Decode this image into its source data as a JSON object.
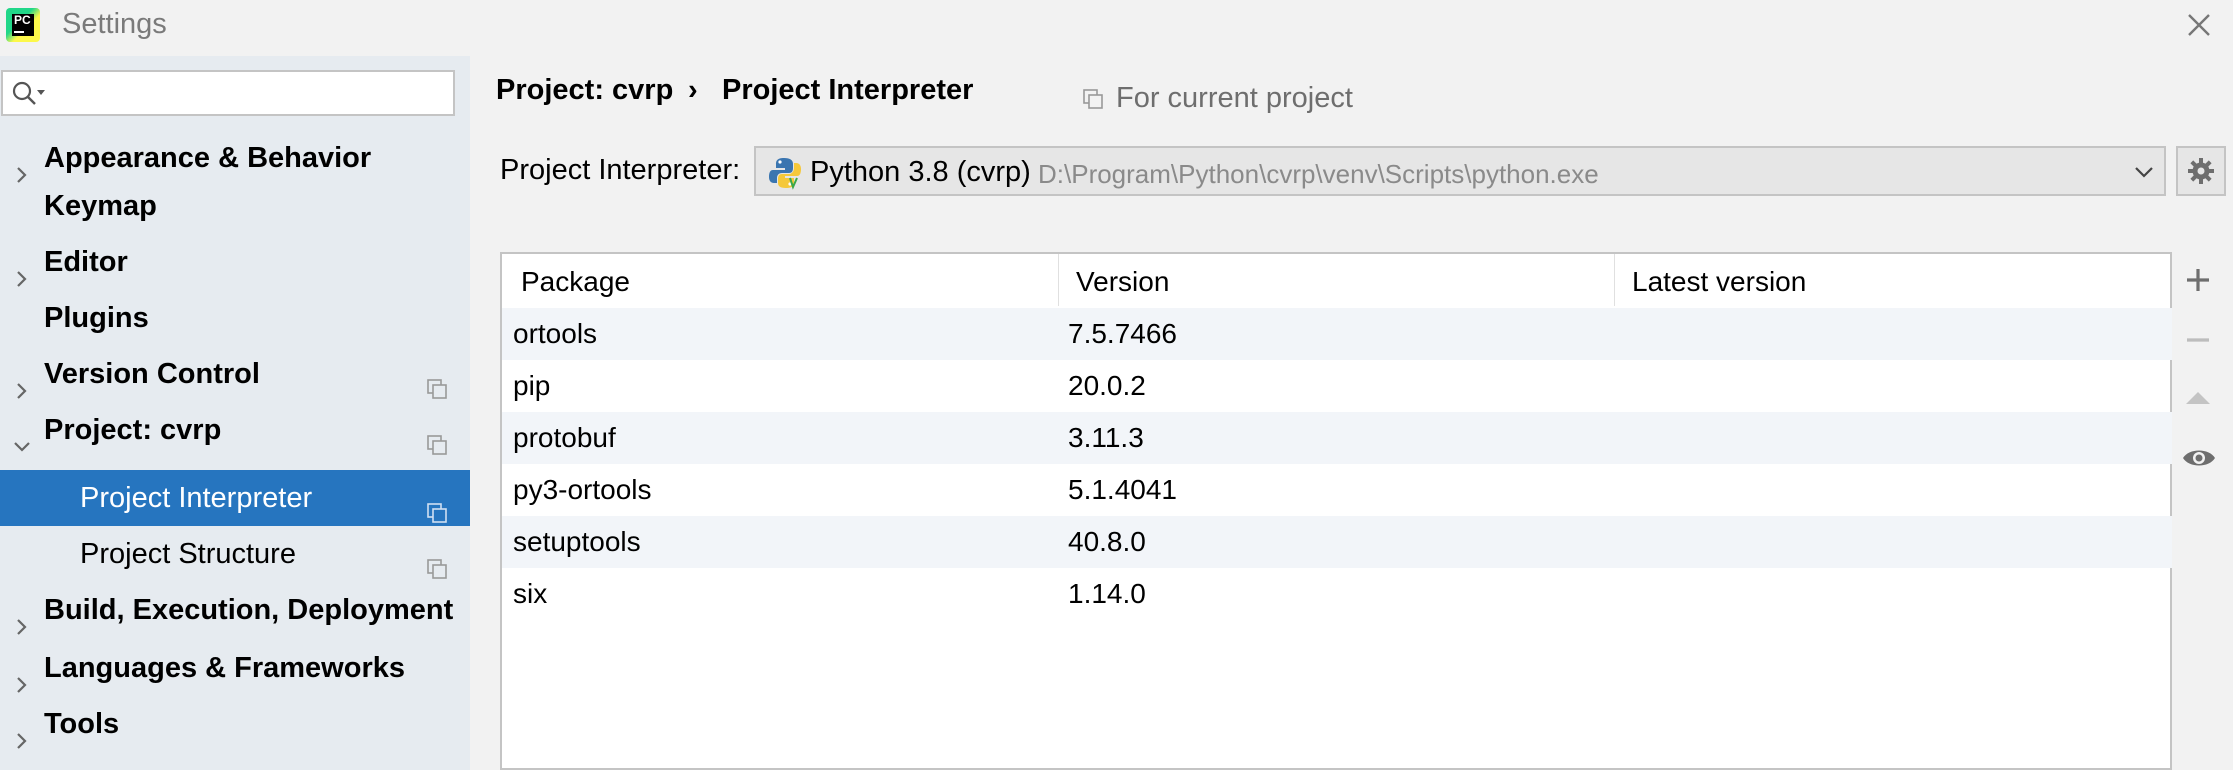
{
  "window": {
    "title": "Settings"
  },
  "search": {
    "value": "",
    "placeholder": ""
  },
  "sidebar": {
    "items": [
      {
        "label": "Appearance & Behavior"
      },
      {
        "label": "Keymap"
      },
      {
        "label": "Editor"
      },
      {
        "label": "Plugins"
      },
      {
        "label": "Version Control"
      },
      {
        "label": "Project: cvrp"
      },
      {
        "label": "Project Interpreter"
      },
      {
        "label": "Project Structure"
      },
      {
        "label": "Build, Execution, Deployment"
      },
      {
        "label": "Languages & Frameworks"
      },
      {
        "label": "Tools"
      }
    ]
  },
  "breadcrumb": {
    "project": "Project: cvrp",
    "separator": "›",
    "page": "Project Interpreter",
    "scope_note": "For current project"
  },
  "interpreter": {
    "label": "Project Interpreter:",
    "name": "Python 3.8 (cvrp)",
    "path": "D:\\Program\\Python\\cvrp\\venv\\Scripts\\python.exe"
  },
  "packages": {
    "columns": [
      "Package",
      "Version",
      "Latest version"
    ],
    "rows": [
      {
        "package": "ortools",
        "version": "7.5.7466",
        "latest": ""
      },
      {
        "package": "pip",
        "version": "20.0.2",
        "latest": ""
      },
      {
        "package": "protobuf",
        "version": "3.11.3",
        "latest": ""
      },
      {
        "package": "py3-ortools",
        "version": "5.1.4041",
        "latest": ""
      },
      {
        "package": "setuptools",
        "version": "40.8.0",
        "latest": ""
      },
      {
        "package": "six",
        "version": "1.14.0",
        "latest": ""
      }
    ]
  },
  "colors": {
    "selected_bg": "#2675bf",
    "sidebar_bg": "#e6ebf0",
    "alt_row_bg": "#f2f5f9"
  },
  "app_logo": {
    "text": "PC"
  }
}
